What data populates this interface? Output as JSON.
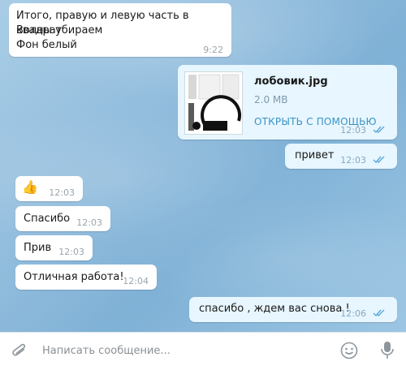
{
  "messages": [
    {
      "lines": [
        "Итого, правую и левую часть в квадрат",
        "Волны убираем",
        "Фон белый"
      ],
      "time": "9:22"
    },
    {
      "file_name": "лобовик.jpg",
      "file_size": "2.0 MB",
      "open_label": "ОТКРЫТЬ С ПОМОЩЬЮ",
      "time": "12:03"
    },
    {
      "text": "привет",
      "time": "12:03"
    },
    {
      "emoji": "👍",
      "time": "12:03"
    },
    {
      "text": "Спасибо",
      "time": "12:03"
    },
    {
      "text": "Прив",
      "time": "12:03"
    },
    {
      "text": "Отличная работа!",
      "time": "12:04"
    },
    {
      "text": "спасибо , ждем вас снова !",
      "time": "12:06"
    }
  ],
  "composer": {
    "placeholder": "Написать сообщение..."
  },
  "icons": {
    "attach": "paperclip-icon",
    "emoji": "emoji-icon",
    "mic": "microphone-icon",
    "read": "double-check-icon"
  },
  "colors": {
    "incoming": "#ffffff",
    "outgoing": "#e7f6ff",
    "link": "#3a93c5",
    "check": "#5aa7d6"
  }
}
